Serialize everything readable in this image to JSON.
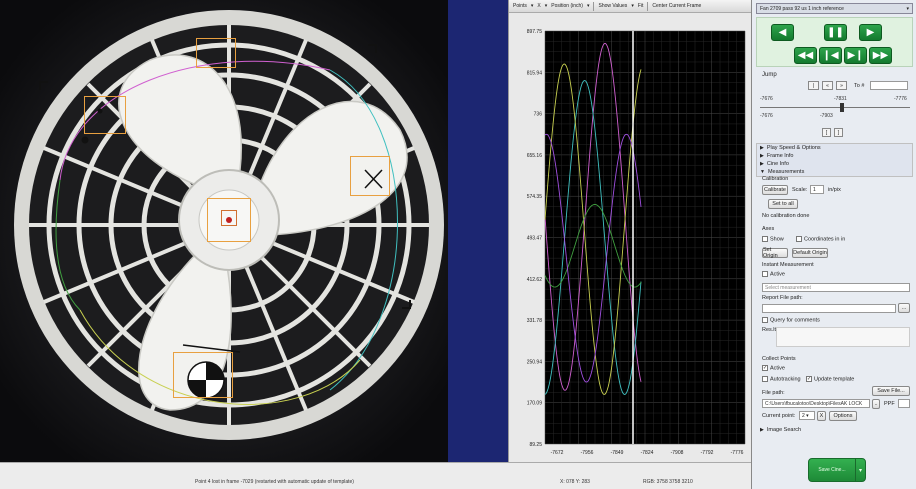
{
  "chart_toolbar": {
    "points": "Points",
    "x": "X",
    "position": "Position (inch)",
    "show_values": "Show Values",
    "fit": "Fit",
    "center": "Center Current Frame"
  },
  "chart_data": {
    "type": "line",
    "y_ticks": [
      "897.75",
      "815.94",
      "736",
      "655.16",
      "574.35",
      "493.47",
      "412.62",
      "331.78",
      "250.94",
      "170.09",
      "89.25"
    ],
    "x_ticks": [
      "-7672",
      "-7956",
      "-7849",
      "-7824",
      "-7908",
      "-7792",
      "-7776"
    ],
    "ylim": [
      89.25,
      897.75
    ],
    "grid": true,
    "background": "#000000",
    "series_colors": [
      "#d060d0",
      "#40c0c0",
      "#c8d050",
      "#40a040",
      "#a050e0"
    ]
  },
  "right_panel": {
    "dropdown": "Fan 2709 pass 92 us 1 inch reference",
    "jump_label": "Jump",
    "to_label": "To #",
    "slider_left_top": "-7676",
    "slider_mid_top": "-7831",
    "slider_right_top": "-7776",
    "slider_left_bot": "-7676",
    "slider_mid_bot": "-7903",
    "sections": [
      "Play Speed & Options",
      "Frame Info",
      "Cine Info",
      "Measurements"
    ],
    "calibration_label": "Calibration",
    "calibrate_btn": "Calibrate",
    "scale_label": "Scale:",
    "scale_value": "1",
    "scale_unit": "in/pix",
    "set_to_all_btn": "Set to all",
    "no_calibration": "No calibration done",
    "axes_label": "Axes",
    "show_label": "Show",
    "coords_label": "Coordinates in in",
    "set_origin_btn": "Set Origin",
    "default_origin_btn": "Default Origin",
    "instant_label": "Instant Measurement",
    "active_label": "Active",
    "select_measurement": "Select measurement",
    "report_label": "Report File path:",
    "query_label": "Query for comments",
    "res_label": "Res.lt",
    "collect_label": "Collect Points",
    "collect_active": "Active",
    "autotracking": "Autotracking",
    "update_template": "Update template",
    "save_file_btn": "Save File...",
    "file_path_label": "File path:",
    "file_path_value": "C:\\Users\\fbucalotoo\\Desktop\\FilesAK LOCK",
    "ppf_label": "PPF",
    "current_point_label": "Current point:",
    "current_point_value": "2",
    "options_btn": "Options",
    "image_search": "Image Search",
    "green_btn": "Save Cine..."
  },
  "status": {
    "message": "Point 4 lost in frame -7029 (restarted with automatic update of template)",
    "coords": "X: 078 Y: 283",
    "rgb": "RGB: 3758 3758 3210"
  }
}
